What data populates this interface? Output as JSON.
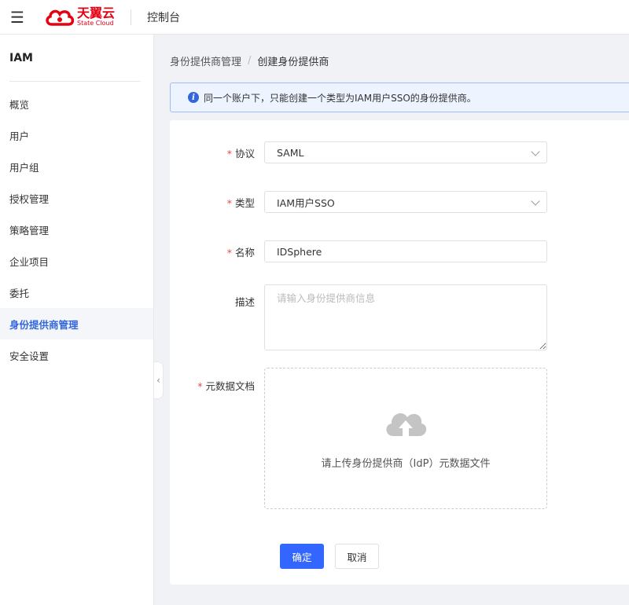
{
  "header": {
    "menu_icon": "hamburger-icon",
    "logo_cn": "天翼云",
    "logo_en": "State Cloud",
    "console_title": "控制台",
    "brand_color": "#e60012"
  },
  "sidebar": {
    "title": "IAM",
    "items": [
      {
        "label": "概览"
      },
      {
        "label": "用户"
      },
      {
        "label": "用户组"
      },
      {
        "label": "授权管理"
      },
      {
        "label": "策略管理"
      },
      {
        "label": "企业项目"
      },
      {
        "label": "委托"
      },
      {
        "label": "身份提供商管理",
        "active": true
      },
      {
        "label": "安全设置"
      }
    ],
    "active_color": "#3366dd"
  },
  "breadcrumb": {
    "parent": "身份提供商管理",
    "separator": "/",
    "current": "创建身份提供商"
  },
  "info_banner": {
    "icon": "info-icon",
    "text": "同一个账户下，只能创建一个类型为IAM用户SSO的身份提供商。"
  },
  "form": {
    "protocol": {
      "label": "协议",
      "required": true,
      "value": "SAML"
    },
    "type": {
      "label": "类型",
      "required": true,
      "value": "IAM用户SSO"
    },
    "name": {
      "label": "名称",
      "required": true,
      "value": "IDSphere"
    },
    "description": {
      "label": "描述",
      "required": false,
      "placeholder": "请输入身份提供商信息"
    },
    "metadata": {
      "label": "元数据文档",
      "required": true,
      "upload_text": "请上传身份提供商（IdP）元数据文件",
      "icon": "cloud-upload-icon"
    },
    "required_mark": "*",
    "confirm_label": "确定",
    "cancel_label": "取消",
    "primary_color": "#3366ff"
  }
}
